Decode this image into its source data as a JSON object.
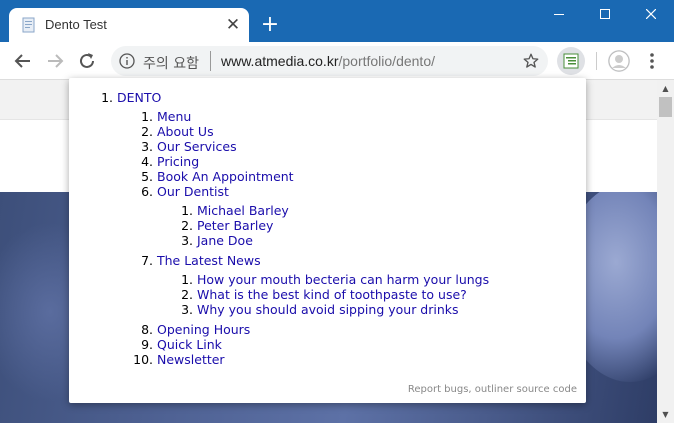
{
  "browser": {
    "tab_title": "Dento Test",
    "security_label": "주의 요함",
    "url_host": "www.atmedia.co.kr",
    "url_path": "/portfolio/dento/",
    "colors": {
      "titlebar": "#1a69b3",
      "link": "#1a0dab"
    }
  },
  "outline": {
    "root": "DENTO",
    "items": {
      "menu": "Menu",
      "about": "About Us",
      "services": "Our Services",
      "pricing": "Pricing",
      "appointment": "Book An Appointment",
      "dentist": "Our Dentist",
      "dentists": [
        "Michael Barley",
        "Peter Barley",
        "Jane Doe"
      ],
      "news": "The Latest News",
      "news_items": [
        "How your mouth becteria can harm your lungs",
        "What is the best kind of toothpaste to use?",
        "Why you should avoid sipping your drinks"
      ],
      "hours": "Opening Hours",
      "quick": "Quick Link",
      "newsletter": "Newsletter"
    },
    "footer": "Report bugs, outliner source code"
  }
}
